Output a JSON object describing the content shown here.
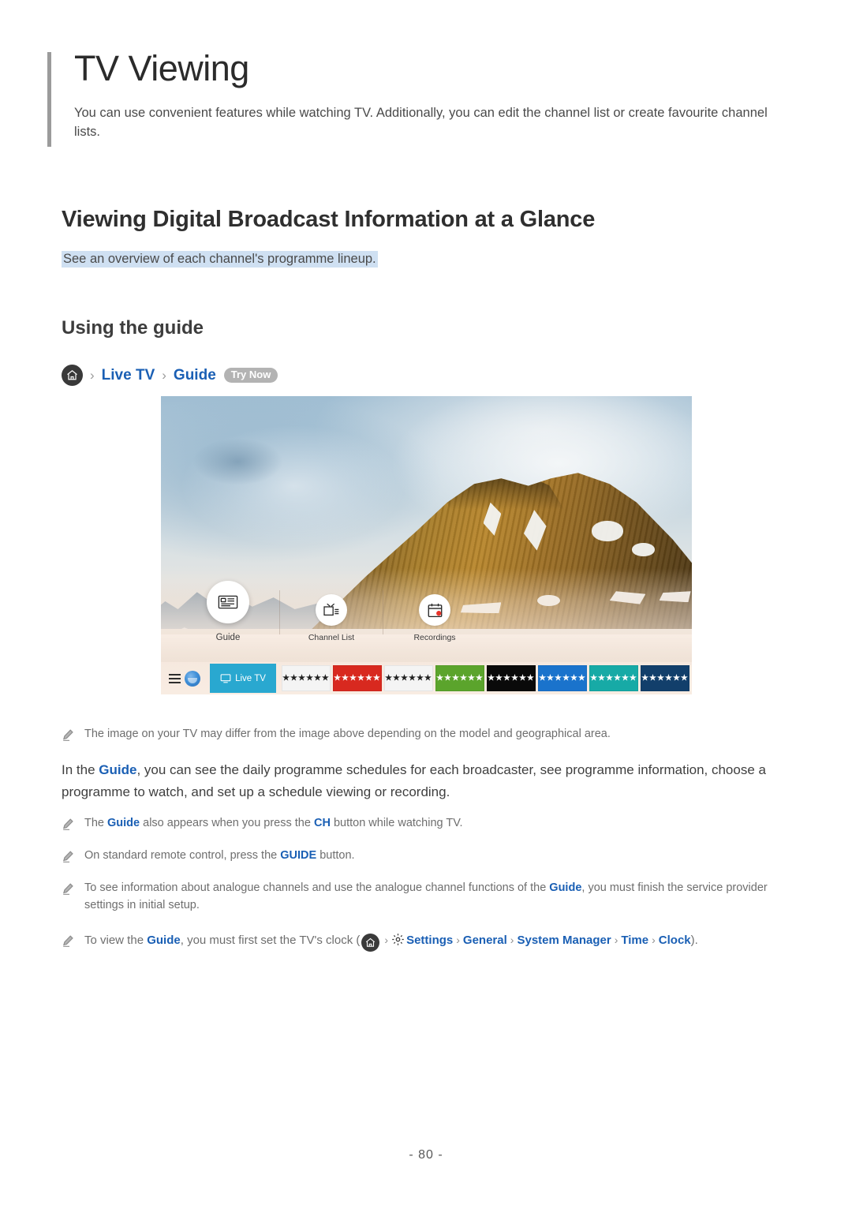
{
  "document": {
    "title": "TV Viewing",
    "intro": "You can use convenient features while watching TV. Additionally, you can edit the channel list or create favourite channel lists.",
    "page_number": "- 80 -"
  },
  "section": {
    "heading": "Viewing Digital Broadcast Information at a Glance",
    "subheading": "See an overview of each channel's programme lineup.",
    "subheading_highlight_color": "#cfe0f2",
    "subsection_heading": "Using the guide"
  },
  "breadcrumb": {
    "home_icon": "home-icon",
    "separator": "›",
    "items": [
      {
        "label": "Live TV"
      },
      {
        "label": "Guide"
      }
    ],
    "badge": "Try Now",
    "link_color": "#1a5fb4"
  },
  "tv_screenshot": {
    "alt": "Samsung TV Live TV home bar over a mountain landscape",
    "menu_items": [
      {
        "label": "Guide",
        "icon": "guide-icon",
        "selected": true
      },
      {
        "label": "Channel List",
        "icon": "channel-list-icon",
        "selected": false
      },
      {
        "label": "Recordings",
        "icon": "recordings-icon",
        "selected": false
      }
    ],
    "app_bar": {
      "menu_icon": "hamburger-menu-icon",
      "assistant_icon": "bixby-orb-icon",
      "live_tv_tile": {
        "label": "Live TV",
        "icon": "monitor-icon",
        "color": "#29a8d0"
      },
      "app_tiles": [
        {
          "label": "★★★★★★",
          "bg": "#f4f4f4",
          "fg": "#202020"
        },
        {
          "label": "★★★★★★",
          "bg": "#d8291f",
          "fg": "#ffffff"
        },
        {
          "label": "★★★★★★",
          "bg": "#f4f4f4",
          "fg": "#202020"
        },
        {
          "label": "★★★★★★",
          "bg": "#5ba42c",
          "fg": "#ffffff"
        },
        {
          "label": "★★★★★★",
          "bg": "#0a0a0a",
          "fg": "#ffffff"
        },
        {
          "label": "★★★★★★",
          "bg": "#1a73cc",
          "fg": "#ffffff"
        },
        {
          "label": "★★★★★★",
          "bg": "#17aaa6",
          "fg": "#ffffff"
        },
        {
          "label": "★★★★★★",
          "bg": "#123f6b",
          "fg": "#ffffff"
        }
      ]
    }
  },
  "notes": {
    "image_disclaimer": "The image on your TV may differ from the image above depending on the model and geographical area.",
    "body_paragraph": {
      "before": "In the ",
      "link": "Guide",
      "after": ", you can see the daily programme schedules for each broadcaster, see programme information, choose a programme to watch, and set up a schedule viewing or recording."
    },
    "note_ch": {
      "p1": "The ",
      "l1": "Guide",
      "p2": " also appears when you press the ",
      "l2": "CH",
      "p3": " button while watching TV."
    },
    "note_guide_button": {
      "p1": "On standard remote control, press the ",
      "l1": "GUIDE",
      "p2": " button."
    },
    "note_analogue": {
      "p1": "To see information about analogue channels and use the analogue channel functions of the ",
      "l1": "Guide",
      "p2": ", you must finish the service provider settings in initial setup."
    },
    "note_clock": {
      "p1": "To view the ",
      "l1": "Guide",
      "p2": ", you must first set the TV's clock (",
      "path": [
        {
          "label": "Settings",
          "icon": "gear-icon"
        },
        {
          "label": "General",
          "icon": ""
        },
        {
          "label": "System Manager",
          "icon": ""
        },
        {
          "label": "Time",
          "icon": ""
        },
        {
          "label": "Clock",
          "icon": ""
        }
      ],
      "p3": ")."
    }
  }
}
